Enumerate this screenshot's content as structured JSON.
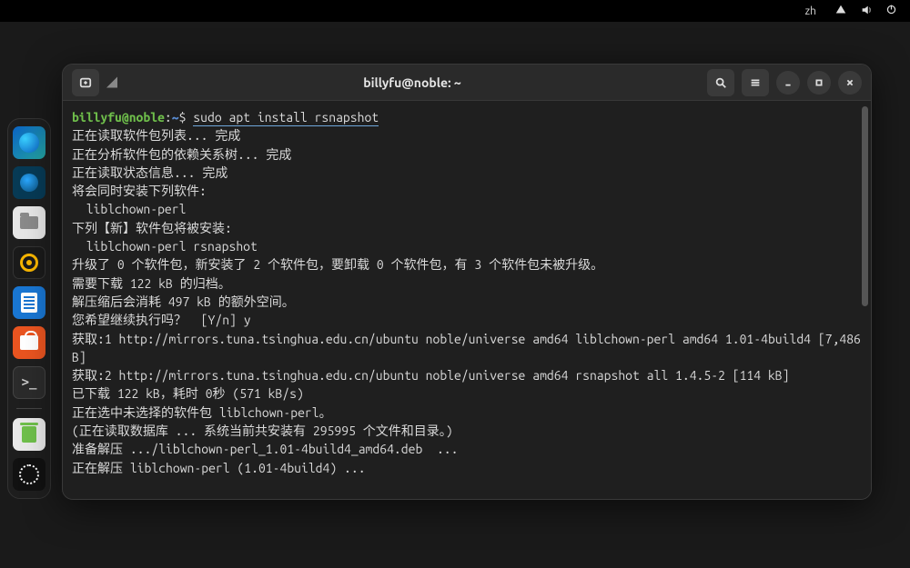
{
  "topbar": {
    "ime": "zh"
  },
  "window": {
    "title": "billyfu@noble: ~",
    "prompt": {
      "user": "billyfu@noble",
      "path": "~",
      "symbol": "$"
    },
    "command": "sudo apt install rsnapshot",
    "lines": [
      "正在读取软件包列表... 完成",
      "正在分析软件包的依赖关系树... 完成",
      "正在读取状态信息... 完成",
      "将会同时安装下列软件:",
      "  liblchown-perl",
      "下列【新】软件包将被安装:",
      "  liblchown-perl rsnapshot",
      "升级了 0 个软件包，新安装了 2 个软件包，要卸载 0 个软件包，有 3 个软件包未被升级。",
      "需要下载 122 kB 的归档。",
      "解压缩后会消耗 497 kB 的额外空间。",
      "您希望继续执行吗？  [Y/n] y",
      "获取:1 http://mirrors.tuna.tsinghua.edu.cn/ubuntu noble/universe amd64 liblchown-perl amd64 1.01-4build4 [7,486 B]",
      "获取:2 http://mirrors.tuna.tsinghua.edu.cn/ubuntu noble/universe amd64 rsnapshot all 1.4.5-2 [114 kB]",
      "已下载 122 kB，耗时 0秒 (571 kB/s)",
      "正在选中未选择的软件包 liblchown-perl。",
      "(正在读取数据库 ... 系统当前共安装有 295995 个文件和目录。)",
      "准备解压 .../liblchown-perl_1.01-4build4_amd64.deb  ...",
      "正在解压 liblchown-perl (1.01-4build4) ..."
    ]
  },
  "dock": {
    "apps": [
      "edge",
      "thunderbird",
      "files",
      "rhythmbox",
      "office",
      "store",
      "terminal",
      "trash",
      "ubuntu"
    ]
  }
}
